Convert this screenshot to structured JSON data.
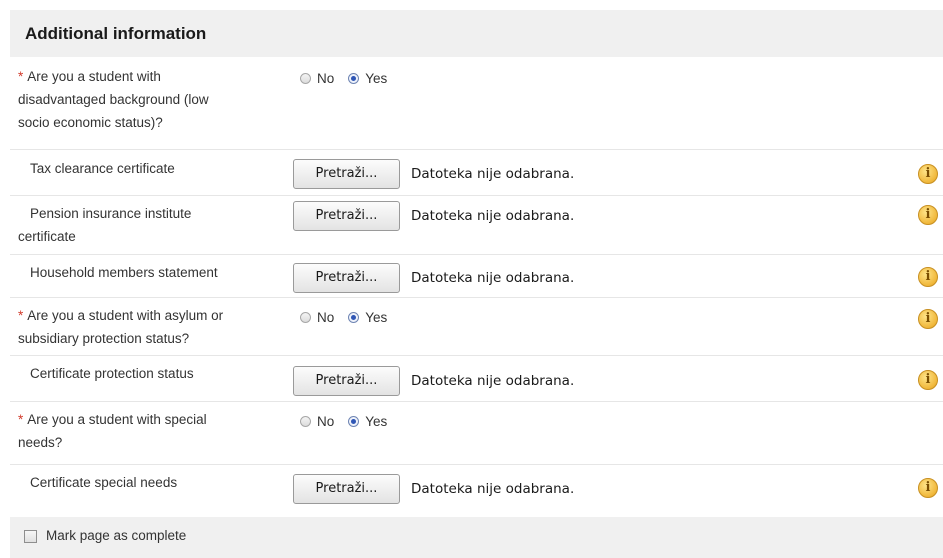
{
  "section": {
    "title": "Additional information"
  },
  "required_marker": "*",
  "rows": [
    {
      "kind": "question",
      "label_lines": [
        "Are you a student with",
        "disadvantaged background (low",
        "socio economic status)?"
      ],
      "options": [
        "No",
        "Yes"
      ],
      "selected": "Yes"
    },
    {
      "kind": "file",
      "label_lines": [
        "Tax clearance certificate"
      ],
      "button": "Pretraži...",
      "status": "Datoteka nije odabrana."
    },
    {
      "kind": "file",
      "label_lines": [
        "Pension insurance institute",
        "certificate"
      ],
      "button": "Pretraži...",
      "status": "Datoteka nije odabrana."
    },
    {
      "kind": "file",
      "label_lines": [
        "Household members statement"
      ],
      "button": "Pretraži...",
      "status": "Datoteka nije odabrana."
    },
    {
      "kind": "question",
      "label_lines": [
        "Are you a student with asylum or",
        "subsidiary protection status?"
      ],
      "options": [
        "No",
        "Yes"
      ],
      "selected": "Yes"
    },
    {
      "kind": "file",
      "label_lines": [
        "Certificate protection status"
      ],
      "button": "Pretraži...",
      "status": "Datoteka nije odabrana."
    },
    {
      "kind": "question",
      "label_lines": [
        "Are you a student with special",
        "needs?"
      ],
      "options": [
        "No",
        "Yes"
      ],
      "selected": "Yes"
    },
    {
      "kind": "file",
      "label_lines": [
        "Certificate special needs"
      ],
      "button": "Pretraži...",
      "status": "Datoteka nije odabrana."
    }
  ],
  "info_icon_glyph": "i",
  "footer": {
    "checkbox_label": "Mark page as complete",
    "checked": false
  },
  "colors": {
    "required": "#d23a2b",
    "header_bg": "#f0f0f0",
    "info_icon": "#f0b73a"
  }
}
